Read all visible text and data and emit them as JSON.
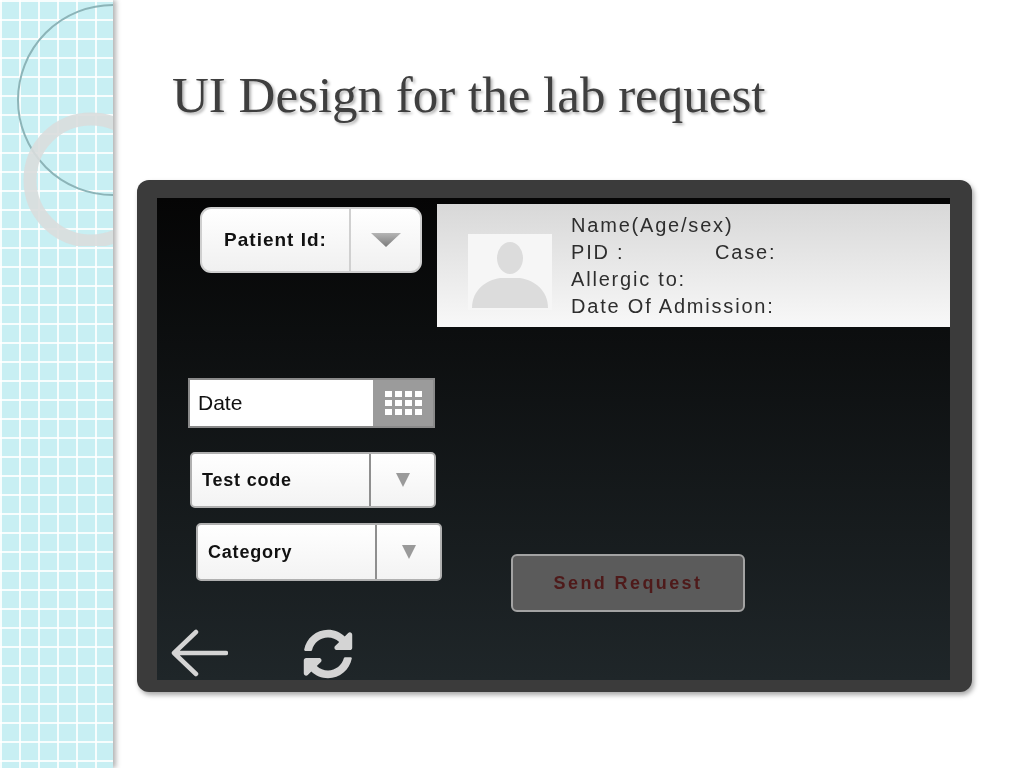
{
  "slide_title": "UI Design for the lab request",
  "mockup": {
    "patient_selector": {
      "label": "Patient Id:"
    },
    "patient_card": {
      "name_age_sex": "Name(Age/sex)",
      "pid": "PID :",
      "case": "Case:",
      "allergic_to": "Allergic to:",
      "date_of_admission": "Date Of Admission:"
    },
    "form_fields": [
      {
        "kind": "date",
        "placeholder": "Date"
      },
      {
        "kind": "dropdown",
        "label": "Test code"
      },
      {
        "kind": "dropdown",
        "label": "Category"
      }
    ],
    "send_button": {
      "label": "Send Request"
    }
  }
}
